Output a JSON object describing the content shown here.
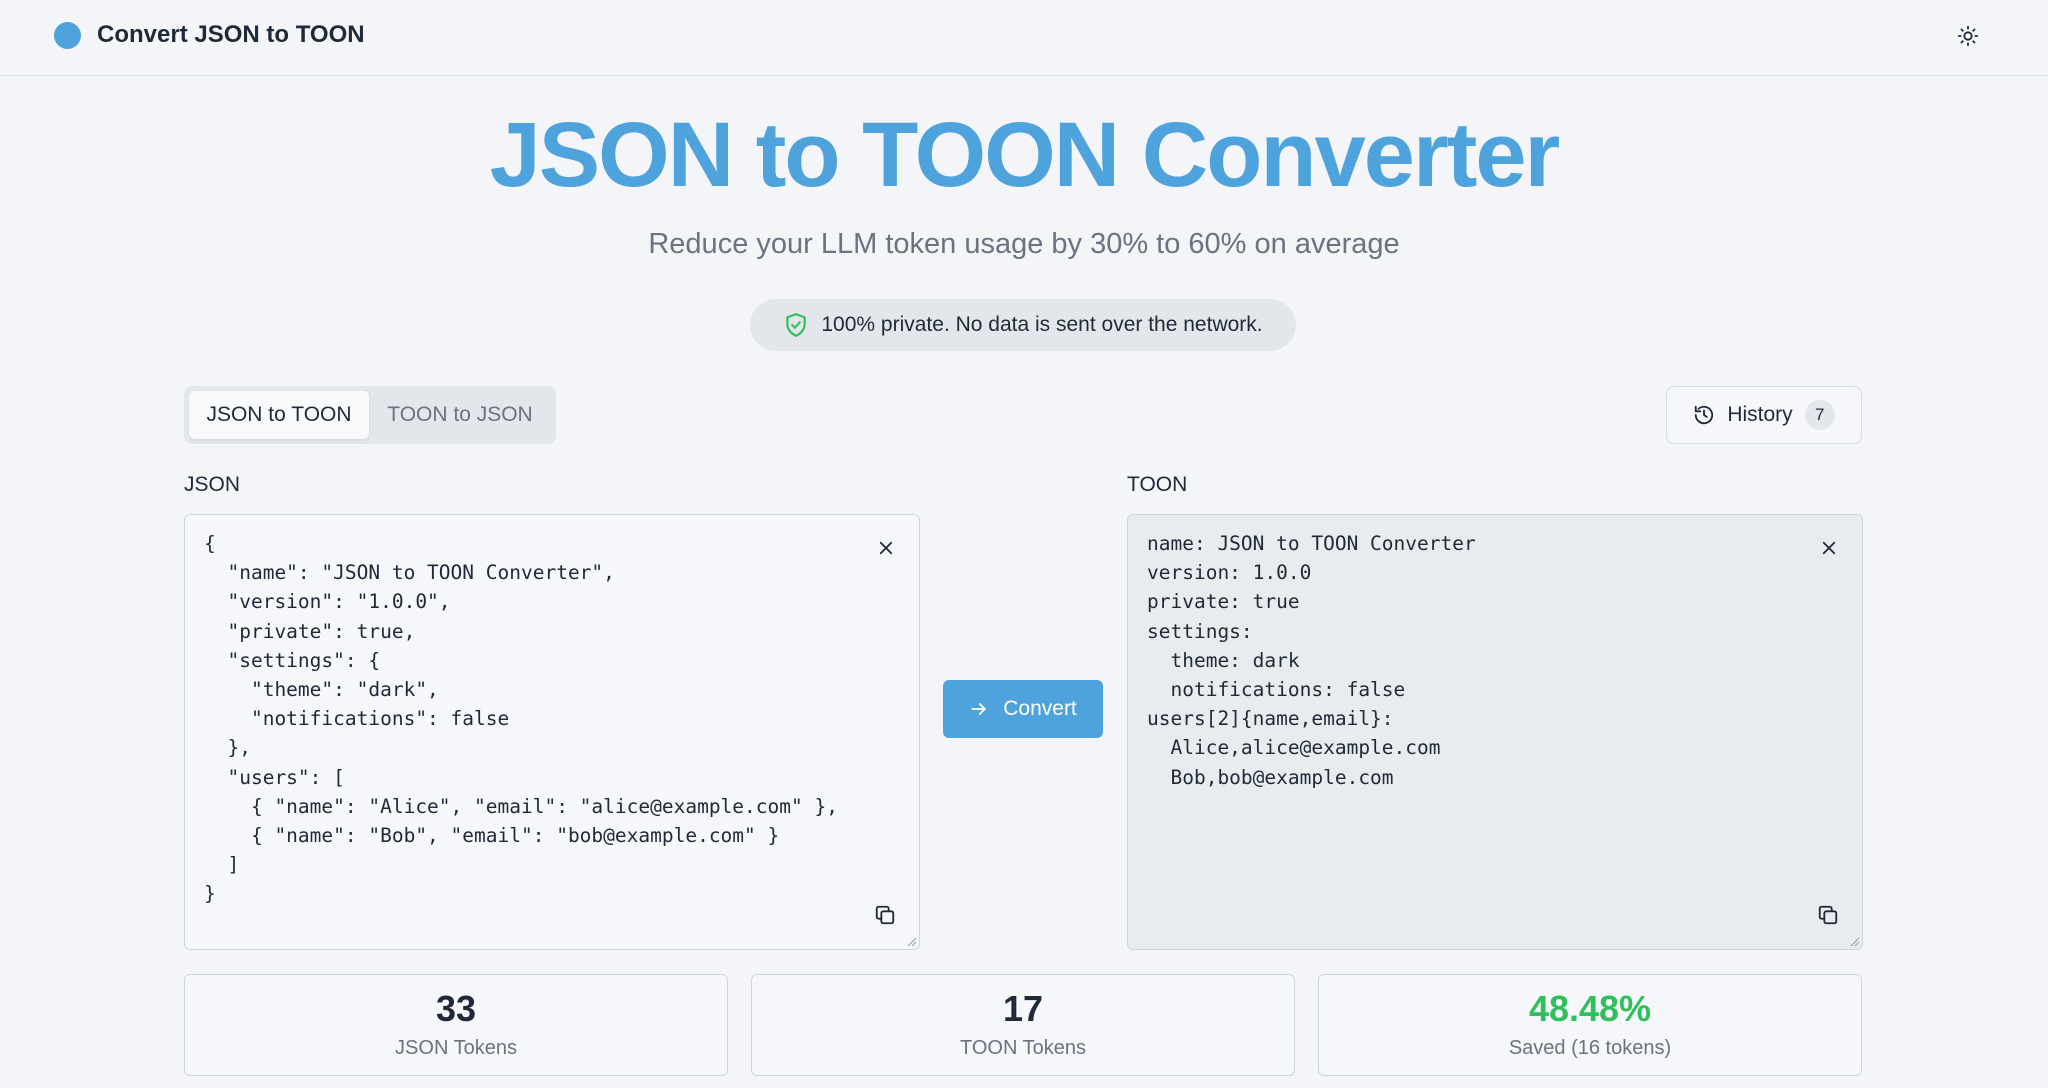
{
  "header": {
    "app_title": "Convert JSON to TOON"
  },
  "hero": {
    "title": "JSON to TOON Converter",
    "subtitle": "Reduce your LLM token usage by 30% to 60% on average",
    "privacy_note": "100% private. No data is sent over the network."
  },
  "mode_tabs": [
    {
      "label": "JSON to TOON",
      "active": true
    },
    {
      "label": "TOON to JSON",
      "active": false
    }
  ],
  "history": {
    "label": "History",
    "count": "7"
  },
  "input_panel": {
    "label": "JSON",
    "content": "{\n  \"name\": \"JSON to TOON Converter\",\n  \"version\": \"1.0.0\",\n  \"private\": true,\n  \"settings\": {\n    \"theme\": \"dark\",\n    \"notifications\": false\n  },\n  \"users\": [\n    { \"name\": \"Alice\", \"email\": \"alice@example.com\" },\n    { \"name\": \"Bob\", \"email\": \"bob@example.com\" }\n  ]\n}"
  },
  "output_panel": {
    "label": "TOON",
    "content": "name: JSON to TOON Converter\nversion: 1.0.0\nprivate: true\nsettings:\n  theme: dark\n  notifications: false\nusers[2]{name,email}:\n  Alice,alice@example.com\n  Bob,bob@example.com"
  },
  "convert": {
    "label": "Convert"
  },
  "stats": [
    {
      "value": "33",
      "label": "JSON Tokens"
    },
    {
      "value": "17",
      "label": "TOON Tokens"
    },
    {
      "value": "48.48%",
      "label": "Saved (16 tokens)"
    }
  ],
  "colors": {
    "accent": "#4ea3dc",
    "success": "#2fbf5b",
    "background": "#f3f5f8"
  },
  "icons": {
    "brand": "brand-dot-icon",
    "theme_toggle": "sun-icon",
    "privacy": "shield-check-icon",
    "history": "history-icon",
    "clear": "close-icon",
    "copy": "copy-icon",
    "convert": "arrow-right-icon"
  }
}
